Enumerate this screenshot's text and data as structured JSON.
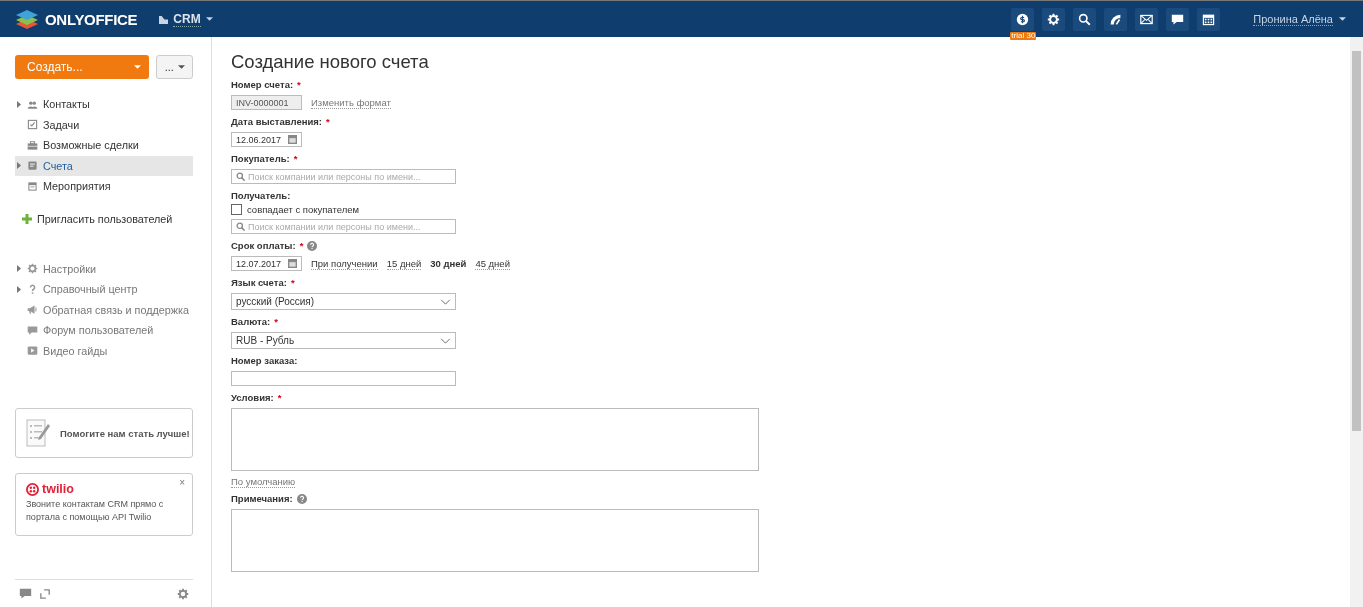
{
  "header": {
    "logo": "ONLYOFFICE",
    "module": "CRM",
    "tools": [
      {
        "kind": "payment",
        "badge": "trial 30"
      },
      {
        "kind": "settings"
      },
      {
        "kind": "search"
      },
      {
        "kind": "feed"
      },
      {
        "kind": "mail"
      },
      {
        "kind": "chat"
      },
      {
        "kind": "calendar"
      }
    ],
    "user": "Пронина Алёна"
  },
  "sidebar": {
    "create_button": "Создать...",
    "more_button": "...",
    "nav": [
      {
        "label": "Контакты",
        "expandable": true,
        "selected": false
      },
      {
        "label": "Задачи",
        "expandable": false,
        "selected": false
      },
      {
        "label": "Возможные сделки",
        "expandable": false,
        "selected": false
      },
      {
        "label": "Счета",
        "expandable": true,
        "selected": true
      },
      {
        "label": "Мероприятия",
        "expandable": false,
        "selected": false
      }
    ],
    "invite": "Пригласить пользователей",
    "help": [
      {
        "label": "Настройки",
        "expandable": true
      },
      {
        "label": "Справочный центр",
        "expandable": true
      },
      {
        "label": "Обратная связь и поддержка",
        "expandable": false
      },
      {
        "label": "Форум пользователей",
        "expandable": false
      },
      {
        "label": "Видео гайды",
        "expandable": false
      }
    ],
    "feedback_card": "Помогите нам стать лучше!",
    "twilio_card": {
      "logo": "twilio",
      "text": "Звоните контактам CRM прямо с портала с помощью API Twilio",
      "close": "×"
    }
  },
  "form": {
    "title": "Создание нового счета",
    "required_mark": "*",
    "fields": [
      {
        "kind": "readonly",
        "label": "Номер счета:",
        "required": true,
        "value": "INV-0000001",
        "link": "Изменить формат"
      },
      {
        "kind": "date",
        "label": "Дата выставления:",
        "required": true,
        "value": "12.06.2017"
      },
      {
        "kind": "search",
        "label": "Покупатель:",
        "required": true,
        "placeholder": "Поиск компании или персоны по имени..."
      },
      {
        "kind": "search",
        "label": "Получатель:",
        "required": false,
        "checkbox": {
          "label": "совпадает с покупателем",
          "checked": false
        },
        "placeholder": "Поиск компании или персоны по имени..."
      },
      {
        "kind": "date",
        "label": "Срок оплаты:",
        "required": true,
        "help": true,
        "value": "12.07.2017",
        "options": [
          {
            "label": "При получении",
            "selected": false
          },
          {
            "label": "15 дней",
            "selected": false
          },
          {
            "label": "30 дней",
            "selected": true
          },
          {
            "label": "45 дней",
            "selected": false
          }
        ]
      },
      {
        "kind": "select",
        "label": "Язык счета:",
        "required": true,
        "value": "русский (Россия)"
      },
      {
        "kind": "select",
        "label": "Валюта:",
        "required": true,
        "value": "RUB - Рубль"
      },
      {
        "kind": "text",
        "label": "Номер заказа:",
        "required": false
      },
      {
        "kind": "textarea",
        "label": "Условия:",
        "required": true,
        "link": "По умолчанию"
      },
      {
        "kind": "textarea",
        "label": "Примечания:",
        "required": false,
        "help": true
      }
    ]
  }
}
